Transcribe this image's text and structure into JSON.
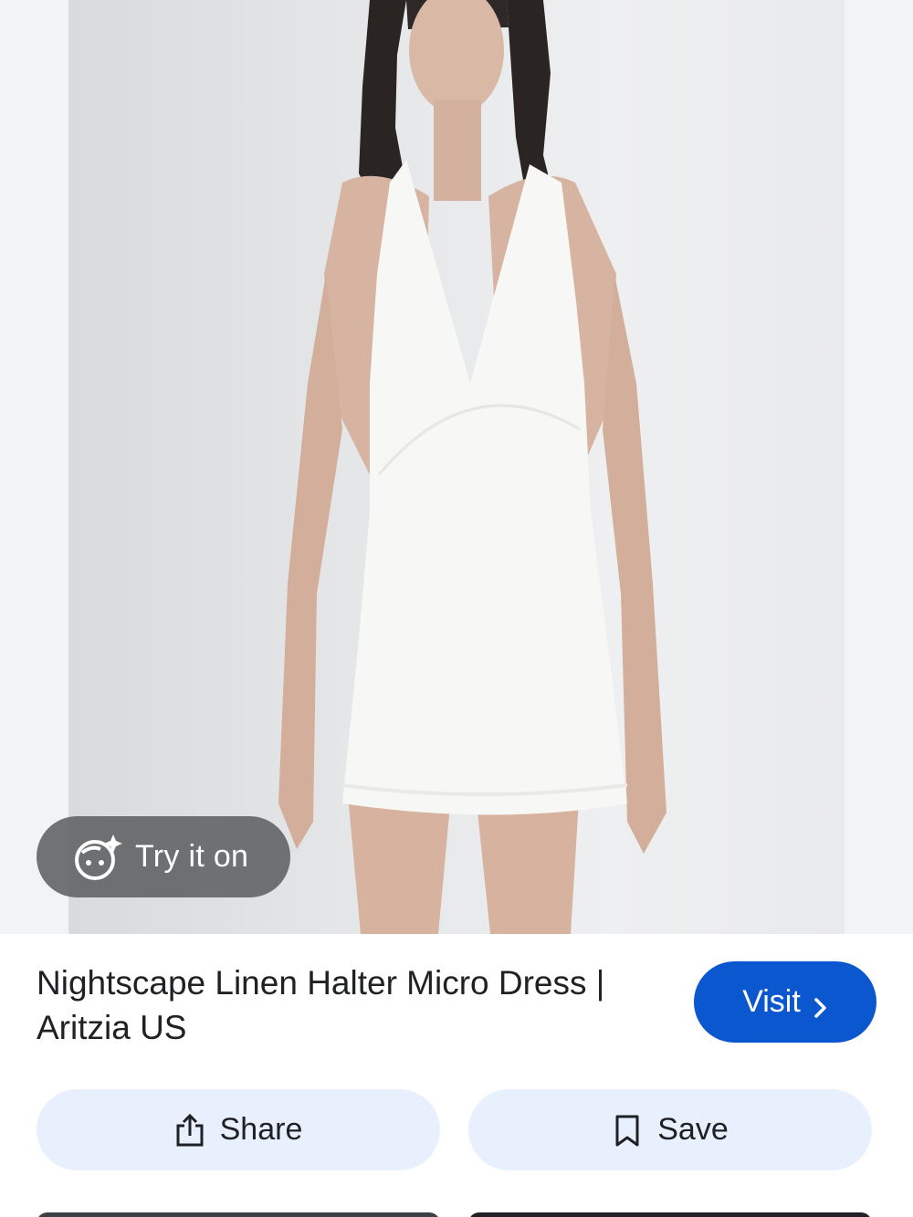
{
  "product": {
    "title": "Nightscape Linen Halter Micro Dress | Aritzia US",
    "image_icon": "product-photo"
  },
  "try_on": {
    "label": "Try it on",
    "icon": "face-sparkle-icon"
  },
  "visit": {
    "label": "Visit",
    "icon": "chevron-right-icon"
  },
  "actions": {
    "share_label": "Share",
    "share_icon": "share-icon",
    "save_label": "Save",
    "save_icon": "bookmark-icon"
  },
  "colors": {
    "primary": "#0b57d0",
    "tonal": "#e8f0fe",
    "text": "#202124"
  }
}
